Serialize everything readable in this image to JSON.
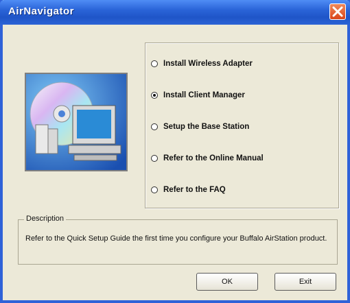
{
  "window": {
    "title": "AirNavigator",
    "close_icon": "close-icon"
  },
  "options": [
    {
      "label": "Install Wireless Adapter",
      "selected": false
    },
    {
      "label": "Install Client Manager",
      "selected": true
    },
    {
      "label": "Setup the Base Station",
      "selected": false
    },
    {
      "label": "Refer to the Online Manual",
      "selected": false
    },
    {
      "label": "Refer to the FAQ",
      "selected": false
    }
  ],
  "description": {
    "legend": "Description",
    "text": "Refer to the Quick Setup Guide the first time you configure your Buffalo AirStation product."
  },
  "buttons": {
    "ok_label": "OK",
    "exit_label": "Exit"
  },
  "colors": {
    "titlebar": "#2a64d8",
    "dialog_bg": "#ece9d8",
    "close_button": "#d9441a"
  }
}
